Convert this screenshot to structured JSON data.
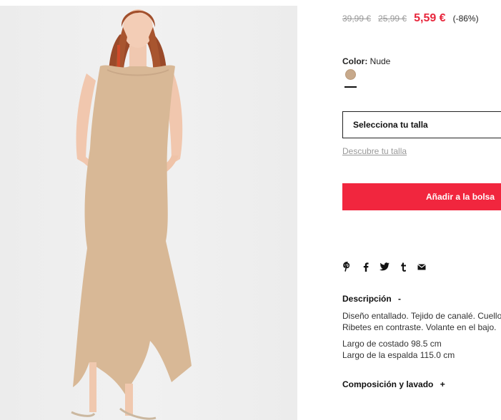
{
  "product": {
    "image_alt": "Vestido canalé volante"
  },
  "prices": {
    "original": "39,99 €",
    "previous": "25,99 €",
    "current": "5,59 €",
    "discount": "(-86%)"
  },
  "color": {
    "label": "Color:",
    "value": "Nude",
    "swatch_hex": "#c7a98b"
  },
  "size": {
    "select_label": "Selecciona tu talla",
    "guide_link": "Descubre tu talla"
  },
  "cart": {
    "add_label": "Añadir a la bolsa",
    "accent": "#f1263e"
  },
  "share": {
    "icons": [
      "pinterest-icon",
      "facebook-icon",
      "twitter-icon",
      "tumblr-icon",
      "email-icon"
    ]
  },
  "description": {
    "title": "Descripción",
    "toggle": "-",
    "line1": "Diseño entallado. Tejido de canalé. Cuello",
    "line2": "Ribetes en contraste. Volante en el bajo.",
    "line3": "Largo de costado 98.5 cm",
    "line4": "Largo de la espalda 115.0 cm"
  },
  "composition": {
    "title": "Composición y lavado",
    "toggle": "+"
  }
}
